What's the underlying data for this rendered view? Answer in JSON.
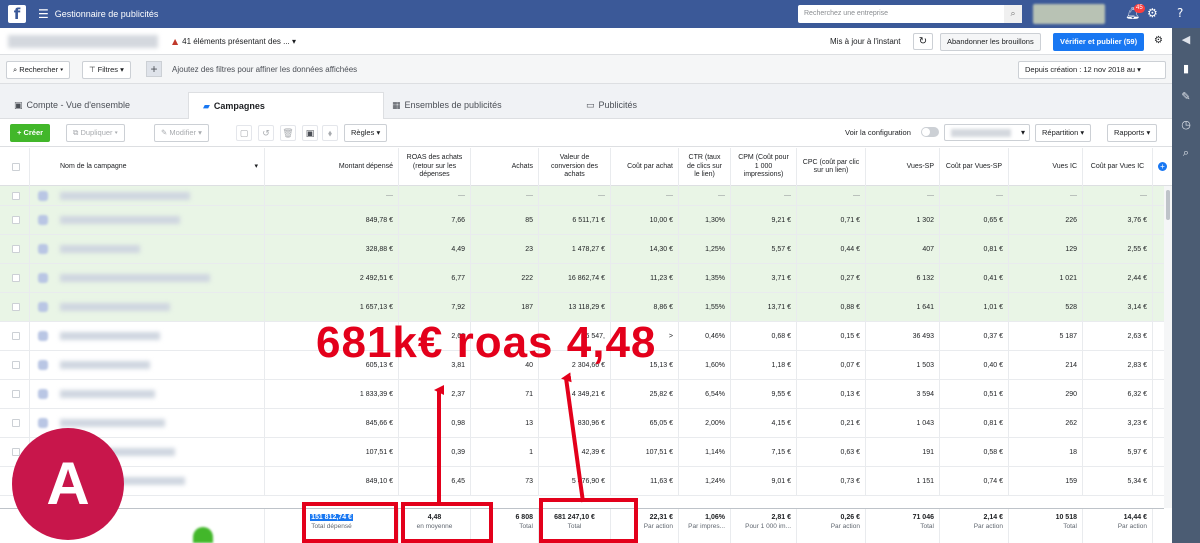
{
  "topbar": {
    "logo": "f",
    "menu_icon": "☰",
    "title": "Gestionnaire de publicités",
    "search_placeholder": "Recherchez une entreprise",
    "notification_count": "45"
  },
  "header": {
    "warning": "41 éléments présentant des ...",
    "updated": "Mis à jour à l'instant",
    "discard_label": "Abandonner les brouillons",
    "publish_label": "Vérifier et publier (59)"
  },
  "filters": {
    "search_label": "Rechercher",
    "filters_label": "Filtres",
    "add_icon": "+",
    "hint": "Ajoutez des filtres pour affiner les données affichées",
    "date_range": "Depuis création : 12 nov 2018 au"
  },
  "tabs": [
    {
      "label": "Compte - Vue d'ensemble"
    },
    {
      "label": "Campagnes"
    },
    {
      "label": "Ensembles de publicités"
    },
    {
      "label": "Publicités"
    }
  ],
  "toolbar": {
    "create_label": "Créer",
    "duplicate_label": "Dupliquer",
    "edit_label": "Modifier",
    "rules_label": "Règles",
    "view_config_label": "Voir la configuration",
    "breakdown_label": "Répartition",
    "reports_label": "Rapports"
  },
  "table": {
    "columns": [
      {
        "label": "Nom de la campagne"
      },
      {
        "label": "Montant dépensé"
      },
      {
        "label": "ROAS des achats (retour sur les dépenses"
      },
      {
        "label": "Achats"
      },
      {
        "label": "Valeur de conversion des achats"
      },
      {
        "label": "Coût par achat"
      },
      {
        "label": "CTR (taux de clics sur le lien)"
      },
      {
        "label": "CPM (Coût pour 1 000 impressions)"
      },
      {
        "label": "CPC (coût par clic sur un lien)"
      },
      {
        "label": "Vues-SP"
      },
      {
        "label": "Coût par Vues-SP"
      },
      {
        "label": "Vues IC"
      },
      {
        "label": "Coût par Vues IC"
      }
    ],
    "rows": [
      [
        "—",
        "—",
        "—",
        "—",
        "—",
        "—",
        "—",
        "—",
        "—",
        "—",
        "—",
        "—"
      ],
      [
        "849,78 €",
        "7,66",
        "85",
        "6 511,71 €",
        "10,00 €",
        "1,30%",
        "9,21 €",
        "0,71 €",
        "1 302",
        "0,65 €",
        "226",
        "3,76 €"
      ],
      [
        "328,88 €",
        "4,49",
        "23",
        "1 478,27 €",
        "14,30 €",
        "1,25%",
        "5,57 €",
        "0,44 €",
        "407",
        "0,81 €",
        "129",
        "2,55 €"
      ],
      [
        "2 492,51 €",
        "6,77",
        "222",
        "16 862,74 €",
        "11,23 €",
        "1,35%",
        "3,71 €",
        "0,27 €",
        "6 132",
        "0,41 €",
        "1 021",
        "2,44 €"
      ],
      [
        "1 657,13 €",
        "7,92",
        "187",
        "13 118,29 €",
        "8,86 €",
        "1,55%",
        "13,71 €",
        "0,88 €",
        "1 641",
        "1,01 €",
        "528",
        "3,14 €"
      ],
      [
        "",
        "2,68",
        "",
        "36 547,",
        ">",
        "0,46%",
        "0,68 €",
        "0,15 €",
        "36 493",
        "0,37 €",
        "5 187",
        "2,63 €"
      ],
      [
        "605,13 €",
        "3,81",
        "40",
        "2 304,66 €",
        "15,13 €",
        "1,60%",
        "1,18 €",
        "0,07 €",
        "1 503",
        "0,40 €",
        "214",
        "2,83 €"
      ],
      [
        "1 833,39 €",
        "2,37",
        "71",
        "4 349,21 €",
        "25,82 €",
        "6,54%",
        "9,55 €",
        "0,13 €",
        "3 594",
        "0,51 €",
        "290",
        "6,32 €"
      ],
      [
        "845,66 €",
        "0,98",
        "13",
        "830,96 €",
        "65,05 €",
        "2,00%",
        "4,15 €",
        "0,21 €",
        "1 043",
        "0,81 €",
        "262",
        "3,23 €"
      ],
      [
        "107,51 €",
        "0,39",
        "1",
        "42,39 €",
        "107,51 €",
        "1,14%",
        "7,15 €",
        "0,63 €",
        "191",
        "0,58 €",
        "18",
        "5,97 €"
      ],
      [
        "849,10 €",
        "6,45",
        "73",
        "5 476,90 €",
        "11,63 €",
        "1,24%",
        "9,01 €",
        "0,73 €",
        "1 151",
        "0,74 €",
        "159",
        "5,34 €"
      ]
    ],
    "totals": [
      {
        "value": "151 812,74 €",
        "label": "Total dépensé"
      },
      {
        "value": "4,48",
        "label": "en moyenne"
      },
      {
        "value": "6 808",
        "label": "Total"
      },
      {
        "value": "681 247,10 €",
        "label": "Total"
      },
      {
        "value": "22,31 €",
        "label": "Par action"
      },
      {
        "value": "1,06%",
        "label": "Par impres..."
      },
      {
        "value": "2,81 €",
        "label": "Pour 1 000 im..."
      },
      {
        "value": "0,26 €",
        "label": "Par action"
      },
      {
        "value": "71 046",
        "label": "Total"
      },
      {
        "value": "2,14 €",
        "label": "Par action"
      },
      {
        "value": "10 518",
        "label": "Total"
      },
      {
        "value": "14,44 €",
        "label": "Par action"
      }
    ]
  },
  "annotation": {
    "headline": "681k€ roas 4,48",
    "color": "#e3001b"
  },
  "avatar": {
    "letter": "A",
    "color": "#c8164b"
  },
  "colors": {
    "brand": "#3b5998",
    "primary": "#1877f2",
    "create": "#42b72a",
    "row_highlight": "#e9f5e6"
  }
}
